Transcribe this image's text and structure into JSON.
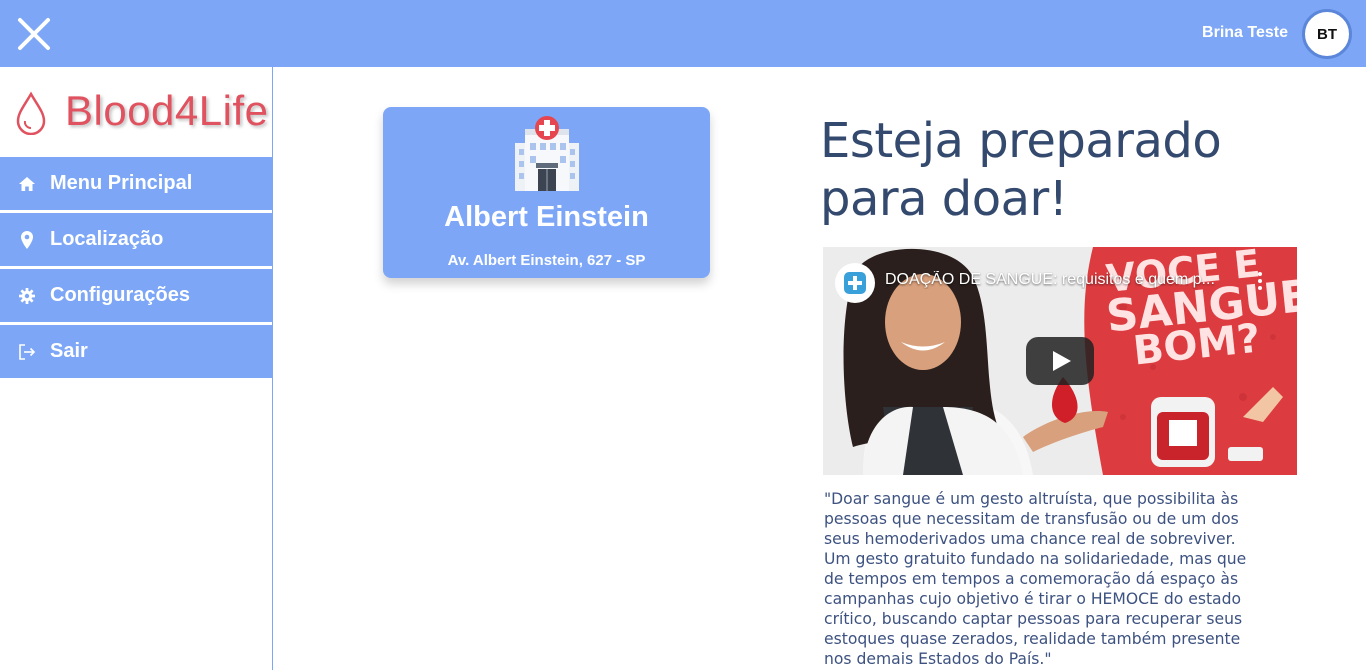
{
  "header": {
    "user_name": "Brina Teste",
    "avatar_initials": "BT",
    "close_icon": "close-icon"
  },
  "sidebar": {
    "logo_text": "Blood4Life",
    "items": [
      {
        "label": "Menu Principal",
        "icon": "home-icon"
      },
      {
        "label": "Localização",
        "icon": "map-pin-icon"
      },
      {
        "label": "Configurações",
        "icon": "gear-icon"
      },
      {
        "label": "Sair",
        "icon": "logout-icon"
      }
    ]
  },
  "hospital_card": {
    "icon": "hospital-icon",
    "name": "Albert Einstein",
    "address": "Av. Albert Einstein, 627 - SP"
  },
  "main": {
    "headline": "Esteja preparado para doar!",
    "video": {
      "title": "DOAÇÃO DE SANGUE: requisitos e quem p...",
      "overlay_line1": "VOCE E",
      "overlay_line2": "SANGUE",
      "overlay_line3": "BOM?"
    },
    "quote": "\"Doar sangue é um gesto altruísta, que possibilita às pessoas que necessitam de transfusão ou de um dos seus hemoderivados uma chance real de sobreviver. Um gesto gratuito fundado na solidariedade, mas que de tempos em tempos a comemoração dá espaço às campanhas cujo objetivo é tirar o HEMOCE do estado crítico, buscando captar pessoas para recuperar seus estoques quase zerados, realidade também presente nos demais Estados do País.\""
  },
  "colors": {
    "accent": "#7da7f6",
    "brand_red": "#e0525f",
    "text_dark": "#34496e"
  }
}
